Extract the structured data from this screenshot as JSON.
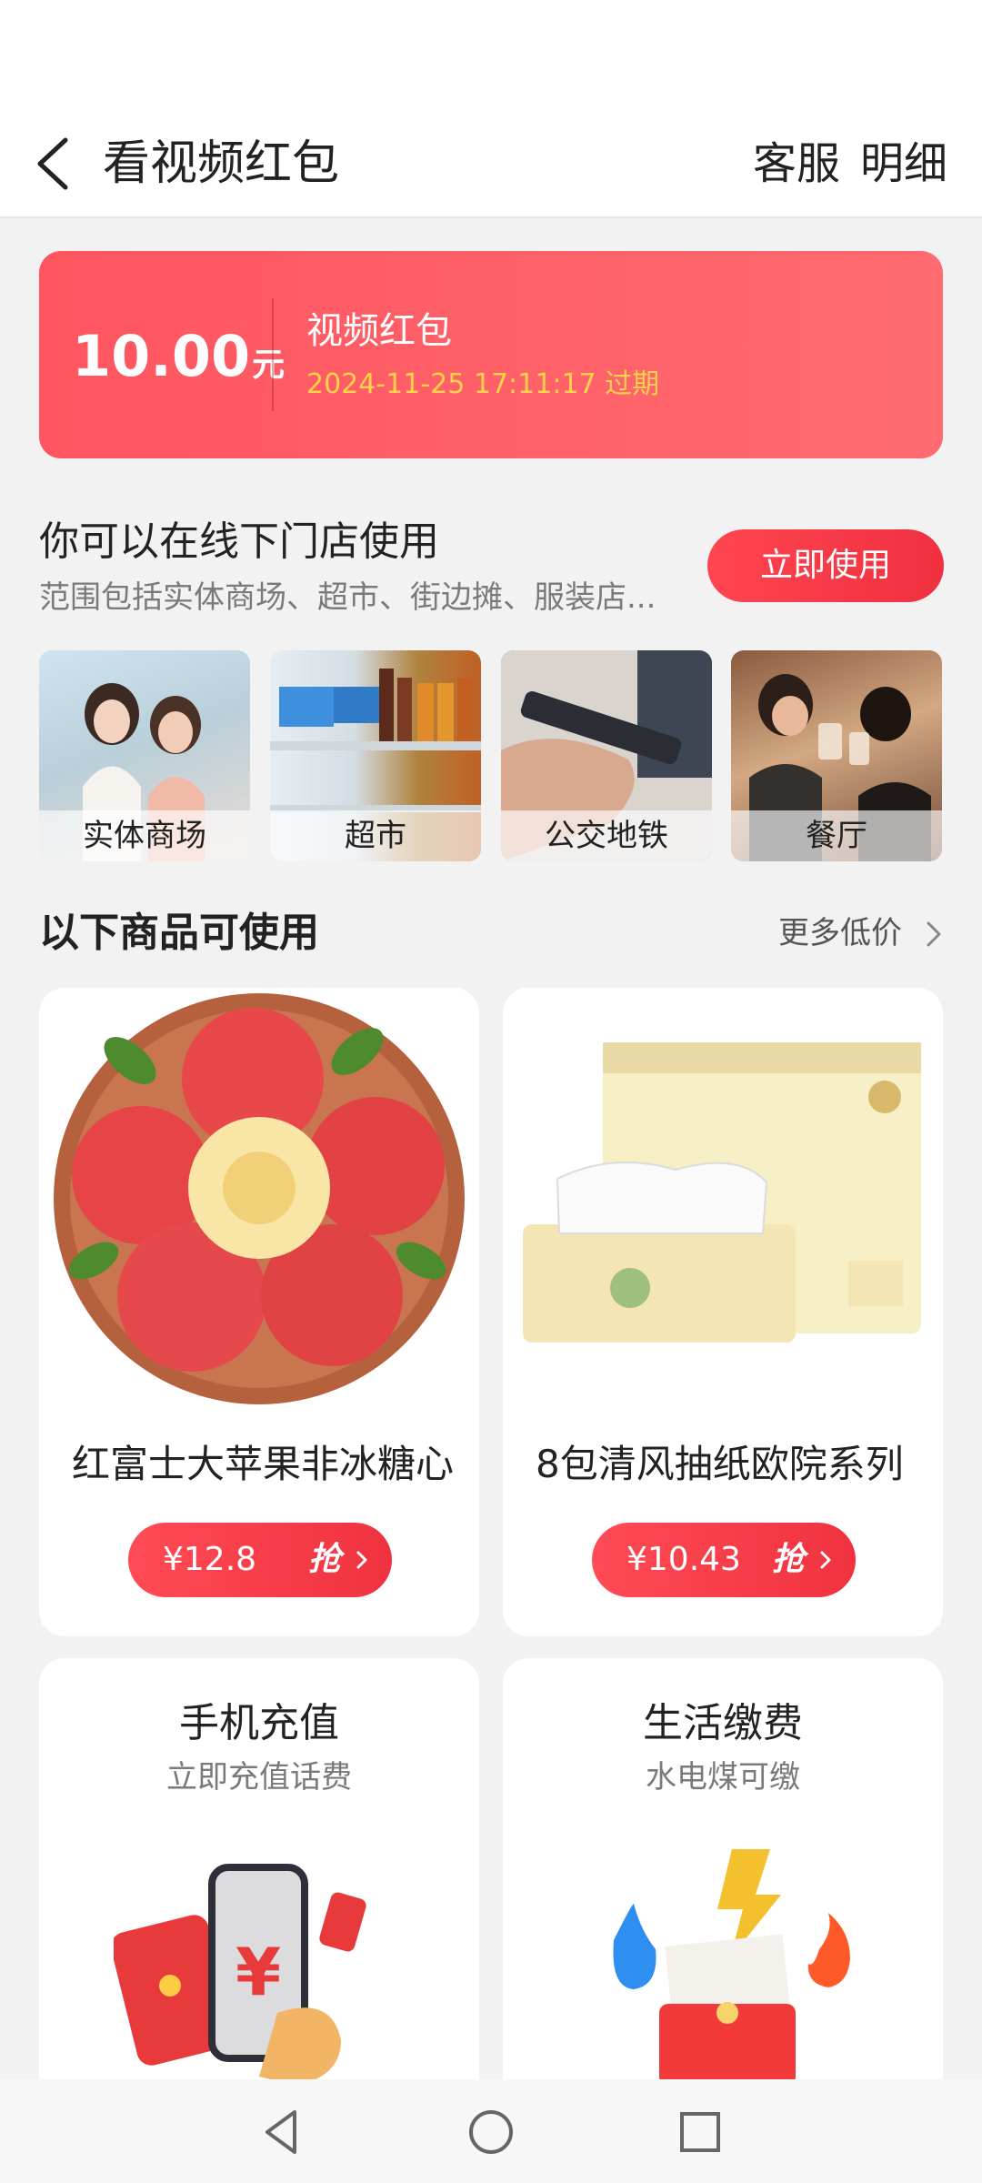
{
  "header": {
    "title": "看视频红包",
    "service_label": "客服",
    "detail_label": "明细"
  },
  "coupon": {
    "amount": "10.00",
    "unit": "元",
    "name": "视频红包",
    "expire": "2024-11-25 17:11:17 过期"
  },
  "offline": {
    "title": "你可以在线下门店使用",
    "subtitle": "范围包括实体商场、超市、街边摊、服装店...",
    "use_button": "立即使用",
    "places": [
      {
        "label": "实体商场"
      },
      {
        "label": "超市"
      },
      {
        "label": "公交地铁"
      },
      {
        "label": "餐厅"
      }
    ]
  },
  "goods": {
    "title": "以下商品可使用",
    "more_label": "更多低价",
    "products": [
      {
        "name": "红富士大苹果非冰糖心",
        "price": "¥12.8",
        "grab": "抢"
      },
      {
        "name": "8包清风抽纸欧院系列",
        "price": "¥10.43",
        "grab": "抢"
      }
    ],
    "services": [
      {
        "title": "手机充值",
        "subtitle": "立即充值话费"
      },
      {
        "title": "生活缴费",
        "subtitle": "水电煤可缴"
      }
    ]
  },
  "colors": {
    "accent": "#ff4b55",
    "coupon_bg": "#ff5d66",
    "expire_text": "#ffd24a",
    "page_bg": "#f2f2f2"
  },
  "icons": {
    "back": "back-arrow-icon",
    "more": "chevron-right-icon",
    "nav": [
      "nav-back-icon",
      "nav-home-icon",
      "nav-recent-icon"
    ]
  }
}
